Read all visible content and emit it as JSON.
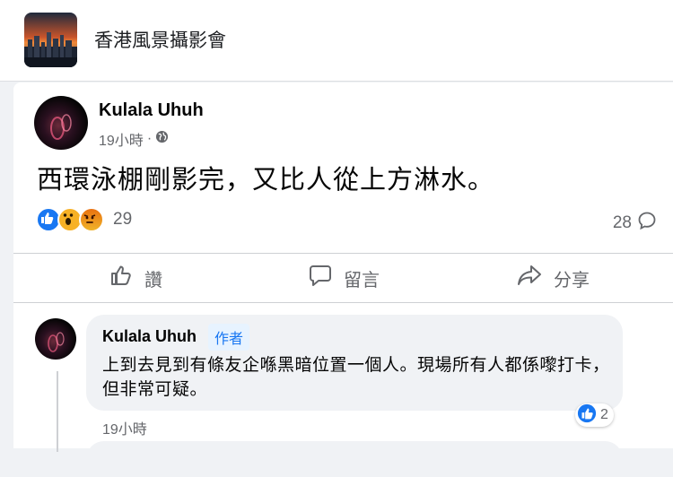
{
  "group": {
    "name": "香港風景攝影會"
  },
  "post": {
    "author": "Kulala Uhuh",
    "time": "19小時",
    "separator": "·",
    "text": "西環泳棚剛影完，又比人從上方淋水。",
    "reaction_count": "29",
    "comment_count": "28",
    "reaction_icons": [
      "like-icon",
      "wow-icon",
      "angry-icon"
    ]
  },
  "actions": {
    "like_label": "讚",
    "comment_label": "留言",
    "share_label": "分享"
  },
  "comment": {
    "author": "Kulala Uhuh",
    "badge": "作者",
    "text": "上到去見到有條友企喺黑暗位置一個人。現場所有人都係嚟打卡，但非常可疑。",
    "time": "19小時",
    "reaction_count": "2"
  },
  "colors": {
    "accent": "#1877f2",
    "muted": "#65676b",
    "background": "#f0f2f5"
  }
}
